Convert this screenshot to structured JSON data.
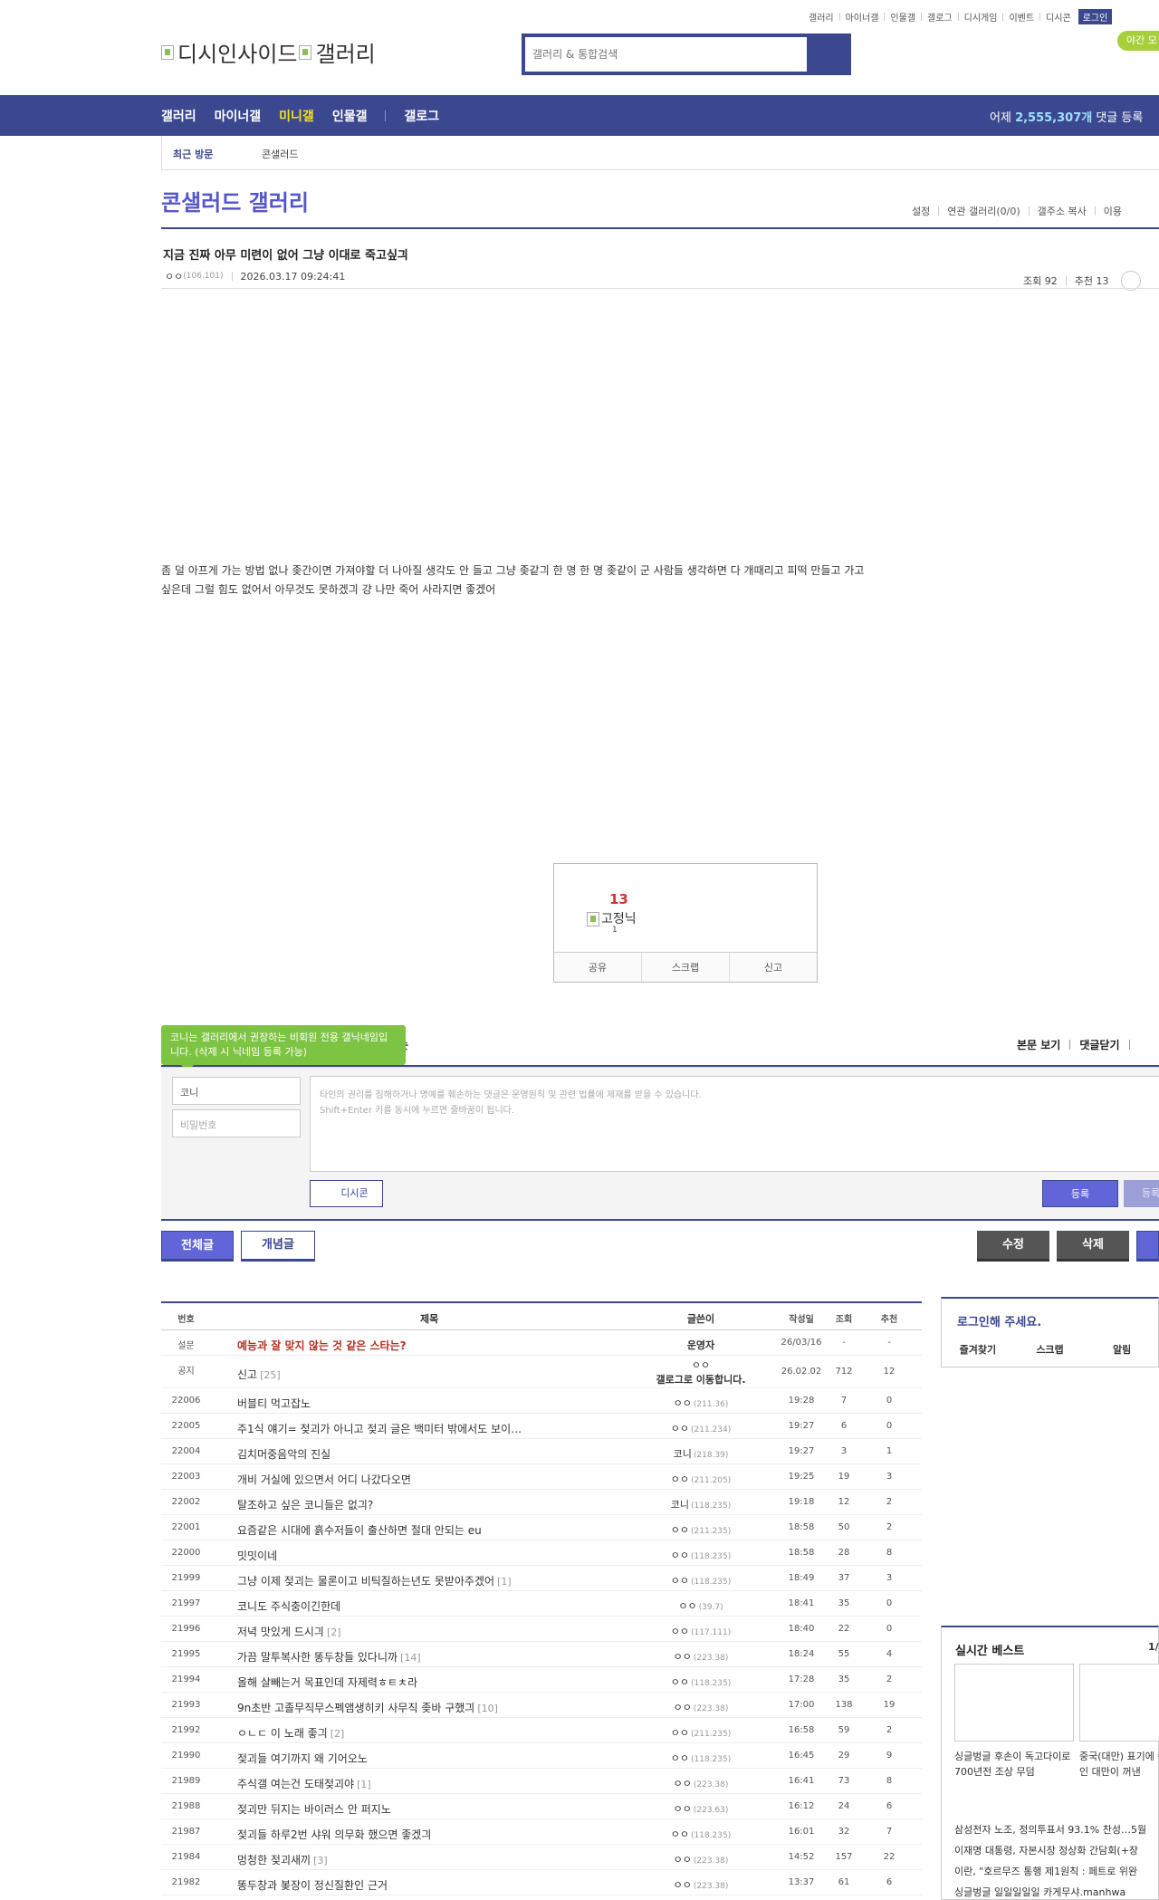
{
  "util_links": [
    "갤러리",
    "마이너갤",
    "인물갤",
    "갤로그",
    "디시게임",
    "이벤트",
    "디시콘"
  ],
  "util_login": "로그인",
  "night_mode": "야간 모",
  "logo": {
    "main": "디시인사이드",
    "sub": "갤러리"
  },
  "search": {
    "placeholder": "갤러리 & 통합검색"
  },
  "nav": {
    "items": [
      "갤러리",
      "마이너갤",
      "미니갤",
      "인물갤",
      "갤로그"
    ],
    "active": "미니갤",
    "stat_prefix": "어제 ",
    "stat_value": "2,555,307개",
    "stat_suffix": " 댓글 등록"
  },
  "subbar": {
    "recent": "최근 방문",
    "gallery": "콘샐러드"
  },
  "gallery": {
    "title": "콘샐러드 갤러리",
    "tools": [
      "설정",
      "연관 갤러리(0/0)",
      "갤주소 복사",
      "이용"
    ]
  },
  "post": {
    "title": "지금 진짜 아무 미련이 없어 그냥 이대로 죽고싶긔",
    "author": "ㅇㅇ",
    "ip": "(106.101)",
    "date": "2026.03.17 09:24:41",
    "views": "조회 92",
    "recommend": "추천 13",
    "body_line1": "좀 덜 아프게 가는 방법 없나 좆간이면 가져야할 더 나아질 생각도 안 들고 그냥 좆같긔 한 명 한 명 좆같이 군 사람들 생각하면 다 개때리고 피떡 만들고 가고",
    "body_line2": "싶은데 그럴 힘도 없어서 아무것도 못하겠긔 걍 나만 죽어 사라지면 좋겠어"
  },
  "recommend_box": {
    "count": "13",
    "fixed_label": "고정닉",
    "fixed_count": "1",
    "buttons": [
      "공유",
      "스크랩",
      "신고"
    ]
  },
  "comment": {
    "tooltip": "코니는 갤러리에서 권장하는 비회원 전용 갤닉네임입니다. (삭제 시 닉네임 등록 가능)",
    "tooltip_tail": "는",
    "view_body": "본문 보기",
    "close": "댓글닫기",
    "nick_value": "코니",
    "password_placeholder": "비밀번호",
    "textarea_line1": "타인의 권리를 침해하거나 명예를 훼손하는 댓글은 운영원칙 및 관련 법률에 제재를 받을 수 있습니다.",
    "textarea_line2": "Shift+Enter 키를 동시에 누르면 줄바꿈이 됩니다.",
    "dccon": "디시콘",
    "submit": "등록",
    "submit2": "등록"
  },
  "list_buttons": {
    "all": "전체글",
    "concept": "개념글",
    "edit": "수정",
    "delete": "삭제"
  },
  "list": {
    "headers": {
      "no": "번호",
      "subject": "제목",
      "writer": "글쓴이",
      "date": "작성일",
      "views": "조회",
      "rec": "추천"
    },
    "rows": [
      {
        "no": "설문",
        "subject": "예능과 잘 맞지 않는 것 같은 스타는?",
        "cnt": "",
        "writer": "운영자",
        "ip": "",
        "date": "26/03/16",
        "views": "-",
        "rec": "-",
        "type": "survey"
      },
      {
        "no": "공지",
        "subject": "신고",
        "cnt": "[25]",
        "writer": "ㅇㅇ",
        "writer2": "갤로그로 이동합니다.",
        "ip": "",
        "date": "26.02.02",
        "views": "712",
        "rec": "12",
        "type": "notice"
      },
      {
        "no": "22006",
        "subject": "버블티 먹고잡노",
        "cnt": "",
        "writer": "ㅇㅇ",
        "ip": "(211.36)",
        "date": "19:28",
        "views": "7",
        "rec": "0"
      },
      {
        "no": "22005",
        "subject": "주1식 얘기= 젖괴가 아니고 젖괴 글은 백미터 밖에서도 보이…",
        "cnt": "",
        "writer": "ㅇㅇ",
        "ip": "(211.234)",
        "date": "19:27",
        "views": "6",
        "rec": "0"
      },
      {
        "no": "22004",
        "subject": "김치머중음악의 진실",
        "cnt": "",
        "writer": "코니",
        "ip": "(218.39)",
        "date": "19:27",
        "views": "3",
        "rec": "1"
      },
      {
        "no": "22003",
        "subject": "개비 거실에 있으면서 어디 나갔다오면",
        "cnt": "",
        "writer": "ㅇㅇ",
        "ip": "(211.205)",
        "date": "19:25",
        "views": "19",
        "rec": "3"
      },
      {
        "no": "22002",
        "subject": "탈조하고 싶은 코니들은 없긔?",
        "cnt": "",
        "writer": "코니",
        "ip": "(118.235)",
        "date": "19:18",
        "views": "12",
        "rec": "2"
      },
      {
        "no": "22001",
        "subject": "요즘같은 시대에 흙수저들이 출산하면 절대 안되는 eu",
        "cnt": "",
        "writer": "ㅇㅇ",
        "ip": "(211.235)",
        "date": "18:58",
        "views": "50",
        "rec": "2"
      },
      {
        "no": "22000",
        "subject": "밋밋이네",
        "cnt": "",
        "writer": "ㅇㅇ",
        "ip": "(118.235)",
        "date": "18:58",
        "views": "28",
        "rec": "8"
      },
      {
        "no": "21999",
        "subject": "그냥 이제 젖괴는 물론이고 비틱질하는년도 못받아주겠어",
        "cnt": "[1]",
        "writer": "ㅇㅇ",
        "ip": "(118.235)",
        "date": "18:49",
        "views": "37",
        "rec": "3"
      },
      {
        "no": "21997",
        "subject": "코니도 주식충이긴한데",
        "cnt": "",
        "writer": "ㅇㅇ",
        "ip": "(39.7)",
        "date": "18:41",
        "views": "35",
        "rec": "0"
      },
      {
        "no": "21996",
        "subject": "저녁 맛있게 드시긔",
        "cnt": "[2]",
        "writer": "ㅇㅇ",
        "ip": "(117.111)",
        "date": "18:40",
        "views": "22",
        "rec": "0"
      },
      {
        "no": "21995",
        "subject": "가끔 말투복사한 똥두창들 있다니까",
        "cnt": "[14]",
        "writer": "ㅇㅇ",
        "ip": "(223.38)",
        "date": "18:24",
        "views": "55",
        "rec": "4"
      },
      {
        "no": "21994",
        "subject": "올해 살빼는거 목표인데 자제력ㅎㅌㅊ라",
        "cnt": "",
        "writer": "ㅇㅇ",
        "ip": "(118.235)",
        "date": "17:28",
        "views": "35",
        "rec": "2"
      },
      {
        "no": "21993",
        "subject": "9n초반 고졸무직무스펙앰생히키 사무직 좆바 구했긔",
        "cnt": "[10]",
        "writer": "ㅇㅇ",
        "ip": "(223.38)",
        "date": "17:00",
        "views": "138",
        "rec": "19"
      },
      {
        "no": "21992",
        "subject": "ㅇㄴㄷ 이 노래 좋긔",
        "cnt": "[2]",
        "writer": "ㅇㅇ",
        "ip": "(211.235)",
        "date": "16:58",
        "views": "59",
        "rec": "2"
      },
      {
        "no": "21990",
        "subject": "젖괴들 여기까지 왜 기어오노",
        "cnt": "",
        "writer": "ㅇㅇ",
        "ip": "(118.235)",
        "date": "16:45",
        "views": "29",
        "rec": "9"
      },
      {
        "no": "21989",
        "subject": "주식갤 여는건 도태젖괴야",
        "cnt": "[1]",
        "writer": "ㅇㅇ",
        "ip": "(223.38)",
        "date": "16:41",
        "views": "73",
        "rec": "8"
      },
      {
        "no": "21988",
        "subject": "젖괴만 뒤지는 바이러스 안 퍼지노",
        "cnt": "",
        "writer": "ㅇㅇ",
        "ip": "(223.63)",
        "date": "16:12",
        "views": "24",
        "rec": "6"
      },
      {
        "no": "21987",
        "subject": "젖괴들 하루2번 샤워 의무화 했으면 좋겠긔",
        "cnt": "",
        "writer": "ㅇㅇ",
        "ip": "(118.235)",
        "date": "16:01",
        "views": "32",
        "rec": "7"
      },
      {
        "no": "21984",
        "subject": "멍청한 젖괴새끼",
        "cnt": "[3]",
        "writer": "ㅇㅇ",
        "ip": "(223.38)",
        "date": "14:52",
        "views": "157",
        "rec": "22"
      },
      {
        "no": "21982",
        "subject": "똥두창과 봊장이 정신질환인 근거",
        "cnt": "",
        "writer": "ㅇㅇ",
        "ip": "(223.38)",
        "date": "13:37",
        "views": "61",
        "rec": "6"
      }
    ]
  },
  "login_box": {
    "title": "로그인해 주세요.",
    "tabs": [
      "즐겨찾기",
      "스크랩",
      "알림"
    ]
  },
  "best": {
    "title": "실시간 베스트",
    "page": "1/",
    "card1": "싱글벙글 후손이 독고다이로 700년전 조상 무덤",
    "card2": "중국(대만) 표기에 중인 대만이 꺼낸",
    "items": [
      "삼성전자 노조, 정의투표서 93.1% 찬성…5월",
      "이재명 대통령, 자본시장 정상화 간담회(+장",
      "이란, \"호르무즈 통행 제1원칙 : 페트로 위완",
      "싱글벙글 일일일일일 카게무샤.manhwa"
    ]
  }
}
